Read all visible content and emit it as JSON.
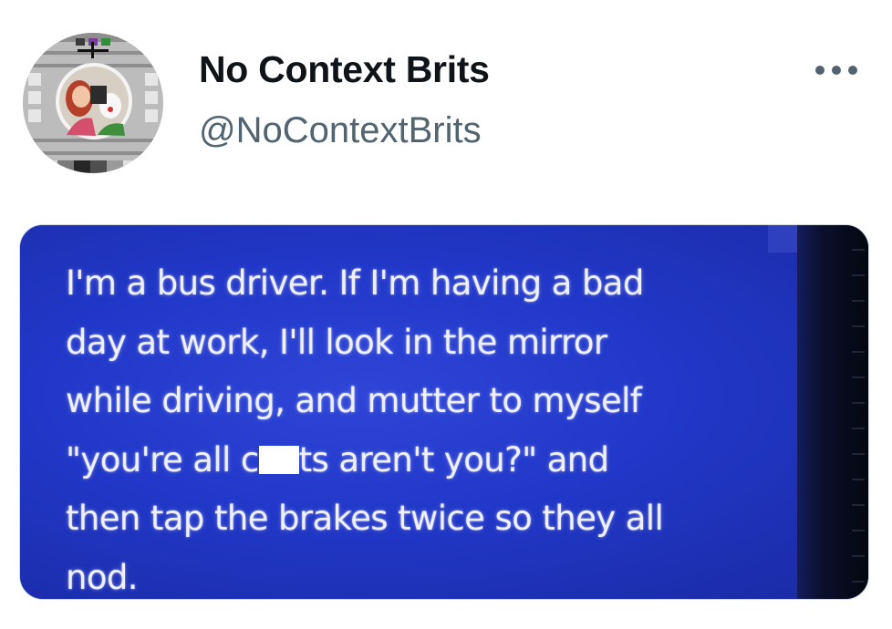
{
  "account": {
    "display_name": "No Context Brits",
    "handle": "@NoContextBrits"
  },
  "more_icon": "more-horizontal-icon",
  "accent_colors": {
    "name": "#0f1419",
    "handle": "#536471",
    "screen_blue": "#2137c7",
    "screen_text": "#eef0ff"
  },
  "media": {
    "lines": [
      "I'm a bus driver. If I'm having a bad",
      "day at work, I'll look in the mirror",
      "while driving, and mutter to myself"
    ],
    "line4_before": "\"you're all c",
    "line4_after": "ts aren't you?\" and",
    "line5": "then tap the brakes twice so they all",
    "line6": "nod."
  }
}
